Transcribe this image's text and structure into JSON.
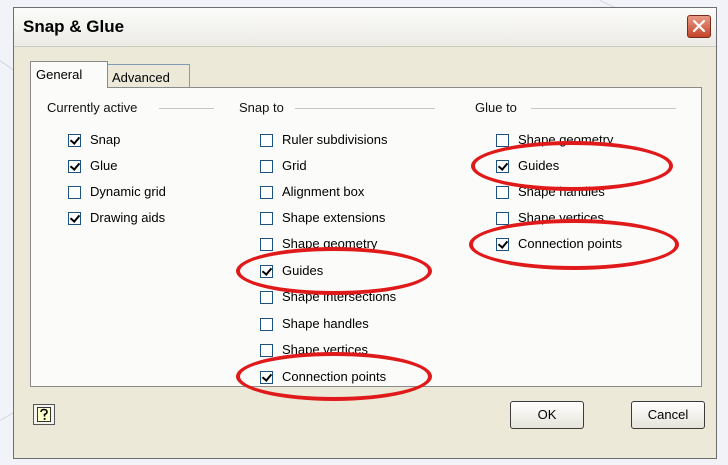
{
  "dialog": {
    "title": "Snap & Glue"
  },
  "tabs": [
    {
      "label": "General",
      "active": true
    },
    {
      "label": "Advanced",
      "active": false
    }
  ],
  "groups": {
    "currently_active": {
      "title": "Currently active",
      "items": [
        {
          "label": "Snap",
          "checked": true
        },
        {
          "label": "Glue",
          "checked": true
        },
        {
          "label": "Dynamic grid",
          "checked": false
        },
        {
          "label": "Drawing aids",
          "checked": true
        }
      ]
    },
    "snap_to": {
      "title": "Snap to",
      "items": [
        {
          "label": "Ruler subdivisions",
          "checked": false
        },
        {
          "label": "Grid",
          "checked": false
        },
        {
          "label": "Alignment box",
          "checked": false
        },
        {
          "label": "Shape extensions",
          "checked": false
        },
        {
          "label": "Shape geometry",
          "checked": false
        },
        {
          "label": "Guides",
          "checked": true
        },
        {
          "label": "Shape intersections",
          "checked": false
        },
        {
          "label": "Shape handles",
          "checked": false
        },
        {
          "label": "Shape vertices",
          "checked": false
        },
        {
          "label": "Connection points",
          "checked": true
        }
      ]
    },
    "glue_to": {
      "title": "Glue to",
      "items": [
        {
          "label": "Shape geometry",
          "checked": false
        },
        {
          "label": "Guides",
          "checked": true
        },
        {
          "label": "Shape handles",
          "checked": false
        },
        {
          "label": "Shape vertices",
          "checked": false
        },
        {
          "label": "Connection points",
          "checked": true
        }
      ]
    }
  },
  "buttons": {
    "ok": "OK",
    "cancel": "Cancel"
  },
  "colors": {
    "annotation": "#e01a1a",
    "close_button": "#c4452a",
    "dialog_face": "#ece9d8"
  },
  "icons": {
    "close": "close-icon",
    "help": "help-icon"
  }
}
